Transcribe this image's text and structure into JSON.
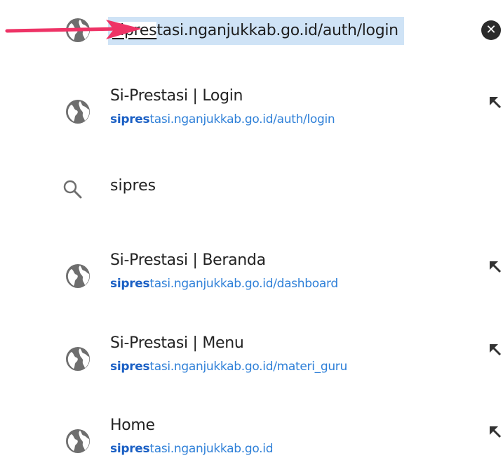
{
  "omnibox": {
    "typed": "sipres",
    "completion": "tasi.nganjukkab.go.id/auth/login"
  },
  "suggestions": [
    {
      "title": "Si-Prestasi | Login",
      "url_match": "sipres",
      "url_rest": "tasi.nganjukkab.go.id/auth/login"
    },
    {
      "query": "sipres"
    },
    {
      "title": "Si-Prestasi | Beranda",
      "url_match": "sipres",
      "url_rest": "tasi.nganjukkab.go.id/dashboard"
    },
    {
      "title": "Si-Prestasi | Menu",
      "url_match": "sipres",
      "url_rest": "tasi.nganjukkab.go.id/materi_guru"
    },
    {
      "title": "Home",
      "url_match": "sipres",
      "url_rest": "tasi.nganjukkab.go.id"
    }
  ],
  "icons": {
    "page": "globe-icon",
    "search": "search-icon",
    "clear": "clear-icon",
    "goto": "arrow-up-left-icon",
    "annotation": "red-arrow-annotation"
  },
  "colors": {
    "url_highlight": "#cfe3f6",
    "url_text": "#2f80d8",
    "url_match": "#1a5fc4",
    "annotation": "#ee3366",
    "icon": "#6e6e6e"
  }
}
